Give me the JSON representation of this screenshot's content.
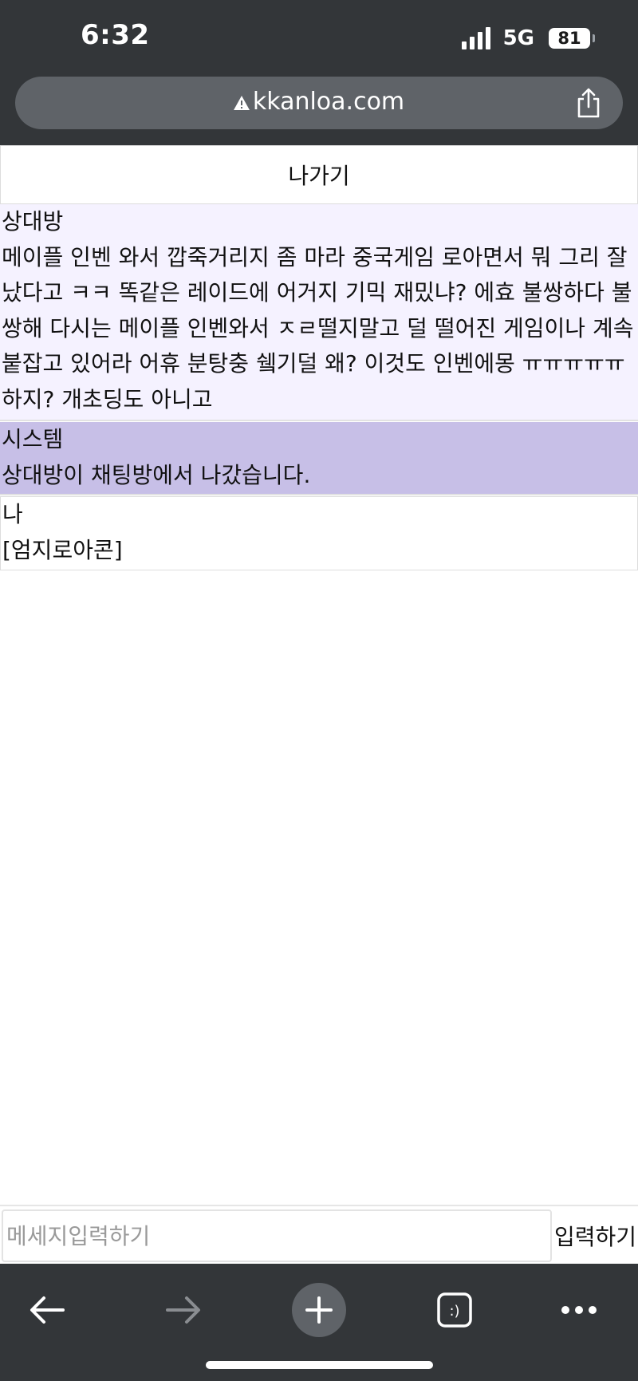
{
  "status_bar": {
    "time": "6:32",
    "network": "5G",
    "battery": "81"
  },
  "browser": {
    "url": "kkanloa.com",
    "icons": {
      "security": "warning-icon",
      "share": "share-icon"
    }
  },
  "chat": {
    "exit_label": "나가기",
    "messages": [
      {
        "sender": "상대방",
        "text": "메이플 인벤 와서 깝죽거리지 좀 마라 중국게임 로아면서 뭐 그리 잘 났다고 ㅋㅋ 똑같은 레이드에 어거지 기믹 재밌냐? 에효 불쌍하다 불쌍해 다시는 메이플 인벤와서 ㅈㄹ떨지말고 덜 떨어진 게임이나 계속 붙잡고 있어라 어휴 분탕충 쉨기덜 왜? 이것도 인벤에몽 ㅠㅠㅠㅠㅠ 하지? 개초딩도 아니고"
      },
      {
        "sender": "시스템",
        "text": "상대방이 채팅방에서 나갔습니다."
      },
      {
        "sender": "나",
        "text": "[엄지로아콘]"
      }
    ],
    "colors": {
      "other_bg": "#f5f2ff",
      "system_bg": "#c7bfe7"
    }
  },
  "composer": {
    "placeholder": "메세지입력하기",
    "value": "",
    "send_label": "입력하기"
  },
  "toolbar": {
    "icons": [
      "back-arrow-icon",
      "forward-arrow-icon",
      "new-tab-plus-icon",
      "tabs-icon",
      "more-icon"
    ]
  }
}
